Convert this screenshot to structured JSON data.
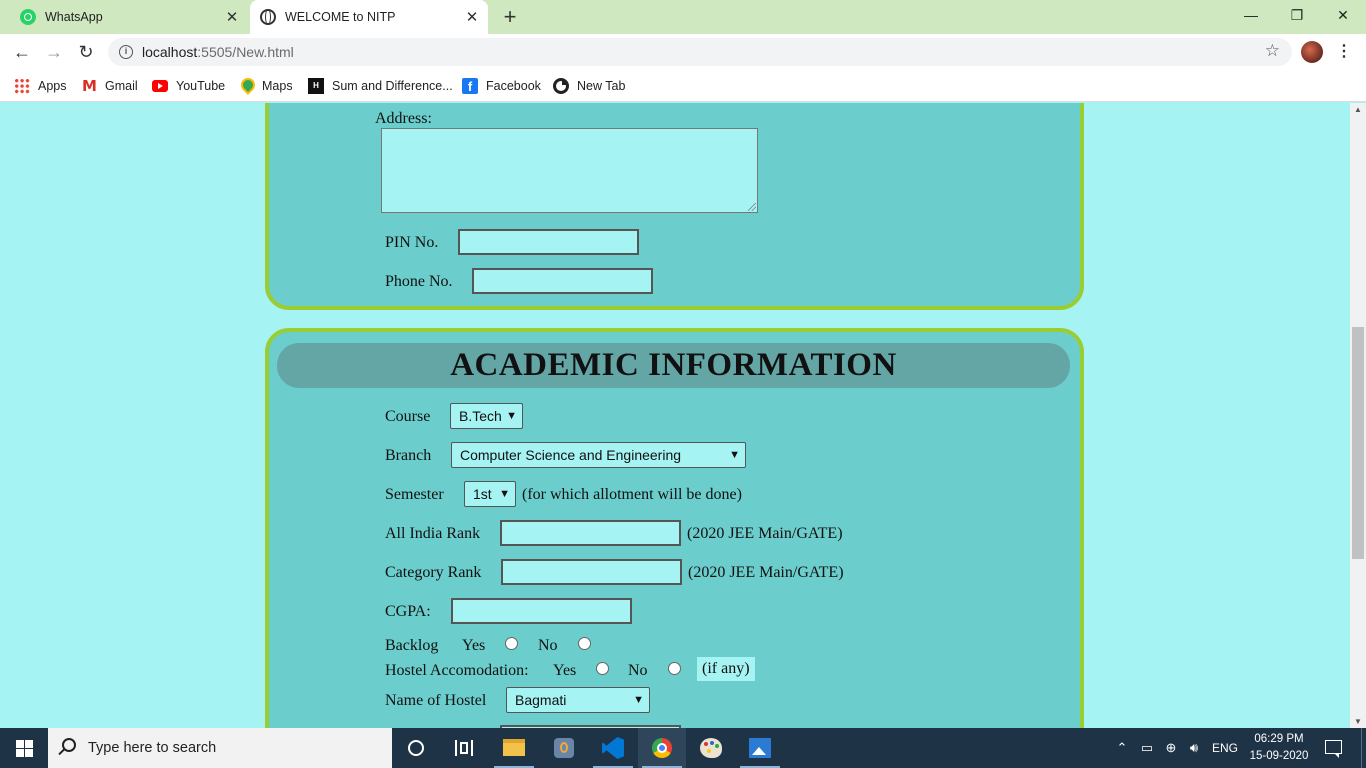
{
  "browser": {
    "tabs": [
      {
        "title": "WhatsApp",
        "active": false,
        "icon": "whatsapp-icon"
      },
      {
        "title": "WELCOME to NITP",
        "active": true,
        "icon": "globe-icon"
      }
    ],
    "new_tab_symbol": "+",
    "window_controls": {
      "minimize": "—",
      "restore": "❐",
      "close": "✕"
    },
    "url": {
      "host": "localhost",
      "path": ":5505/New.html"
    },
    "tab_close_symbol": "✕",
    "bookmarks": [
      {
        "label": "Apps",
        "icon": "apps-grid-icon"
      },
      {
        "label": "Gmail",
        "icon": "gmail-icon"
      },
      {
        "label": "YouTube",
        "icon": "youtube-icon"
      },
      {
        "label": "Maps",
        "icon": "maps-icon"
      },
      {
        "label": "Sum and Difference...",
        "icon": "hackerrank-icon"
      },
      {
        "label": "Facebook",
        "icon": "facebook-icon"
      },
      {
        "label": "New Tab",
        "icon": "new-tab-icon"
      }
    ]
  },
  "contact": {
    "address_label": "Address:",
    "pin_label": "PIN No.",
    "phone_label": "Phone No."
  },
  "academic": {
    "title": "ACADEMIC INFORMATION",
    "course_label": "Course",
    "course_value": "B.Tech",
    "branch_label": "Branch",
    "branch_value": "Computer Science and Engineering",
    "semester_label": "Semester",
    "semester_value": "1st",
    "semester_note": "(for which allotment will be done)",
    "air_label": "All India Rank",
    "air_note": "(2020 JEE Main/GATE)",
    "category_label": "Category Rank",
    "category_note": "(2020 JEE Main/GATE)",
    "cgpa_label": "CGPA:",
    "backlog_label": "Backlog",
    "yes_label": "Yes",
    "no_label": "No",
    "hostel_label": "Hostel Accomodation:",
    "hostel_note": "(if any)",
    "hostel_name_label": "Name of Hostel",
    "hostel_name_value": "Bagmati"
  },
  "taskbar": {
    "search_placeholder": "Type here to search",
    "language": "ENG",
    "time": "06:29 PM",
    "date": "15-09-2020"
  },
  "colors": {
    "page_bg": "#a5f3f3",
    "section_bg": "#6ccdcd",
    "section_border": "#9acd32",
    "title_bg": "#64a6a6",
    "taskbar_bg": "#1f3346"
  }
}
